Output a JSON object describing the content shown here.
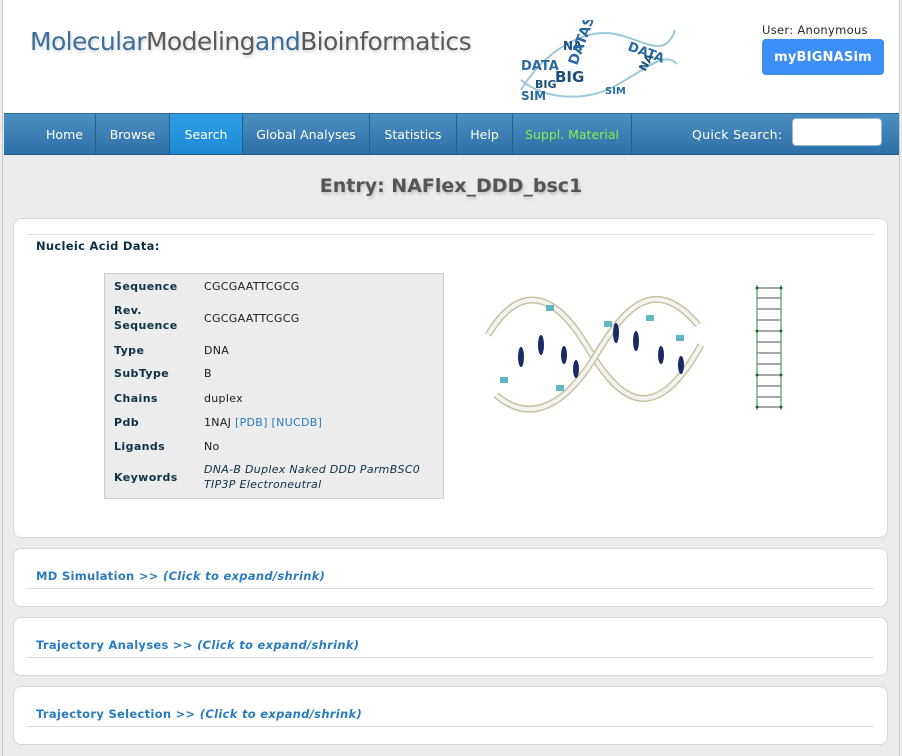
{
  "header": {
    "brand": {
      "w1": "Molecular",
      "w2": "Modeling",
      "w3": "and",
      "w4": "Bioinformatics"
    },
    "user_label": "User: Anonymous",
    "mybig_button": "myBIGNASim",
    "logo_words": [
      "DATA",
      "BIG",
      "SIM",
      "NA",
      "DATASIM",
      "BIG",
      "DATA",
      "NA",
      "SIM"
    ]
  },
  "nav": {
    "items": [
      "Home",
      "Browse",
      "Search",
      "Global Analyses",
      "Statistics",
      "Help",
      "Suppl. Material"
    ],
    "active_item": "Search",
    "quick_search_label": "Quick Search:",
    "quick_search_value": ""
  },
  "entry_title": "Entry: NAFlex_DDD_bsc1",
  "nucleic_panel": {
    "heading": "Nucleic Acid Data:",
    "rows": [
      {
        "key": "Sequence",
        "value": "CGCGAATTCGCG"
      },
      {
        "key": "Rev. Sequence",
        "value": "CGCGAATTCGCG"
      },
      {
        "key": "Type",
        "value": "DNA"
      },
      {
        "key": "SubType",
        "value": "B"
      },
      {
        "key": "Chains",
        "value": "duplex"
      },
      {
        "key": "Pdb",
        "value": "1NAJ",
        "link1": "[PDB]",
        "link2": "[NUCDB]"
      },
      {
        "key": "Ligands",
        "value": "No"
      },
      {
        "key": "Keywords",
        "value": "DNA-B Duplex Naked DDD ParmBSC0 TIP3P Electroneutral"
      }
    ]
  },
  "panels": [
    {
      "heading": "MD Simulation >>",
      "hint": "(Click to expand/shrink)"
    },
    {
      "heading": "Trajectory Analyses >>",
      "hint": "(Click to expand/shrink)"
    },
    {
      "heading": "Trajectory Selection >>",
      "hint": "(Click to expand/shrink)"
    }
  ],
  "colors": {
    "nav_bg": "#2c70a8",
    "nav_active": "#1e8ad6",
    "button": "#3d8ef5",
    "link": "#2a7bbf",
    "suppl": "#88ee44"
  }
}
